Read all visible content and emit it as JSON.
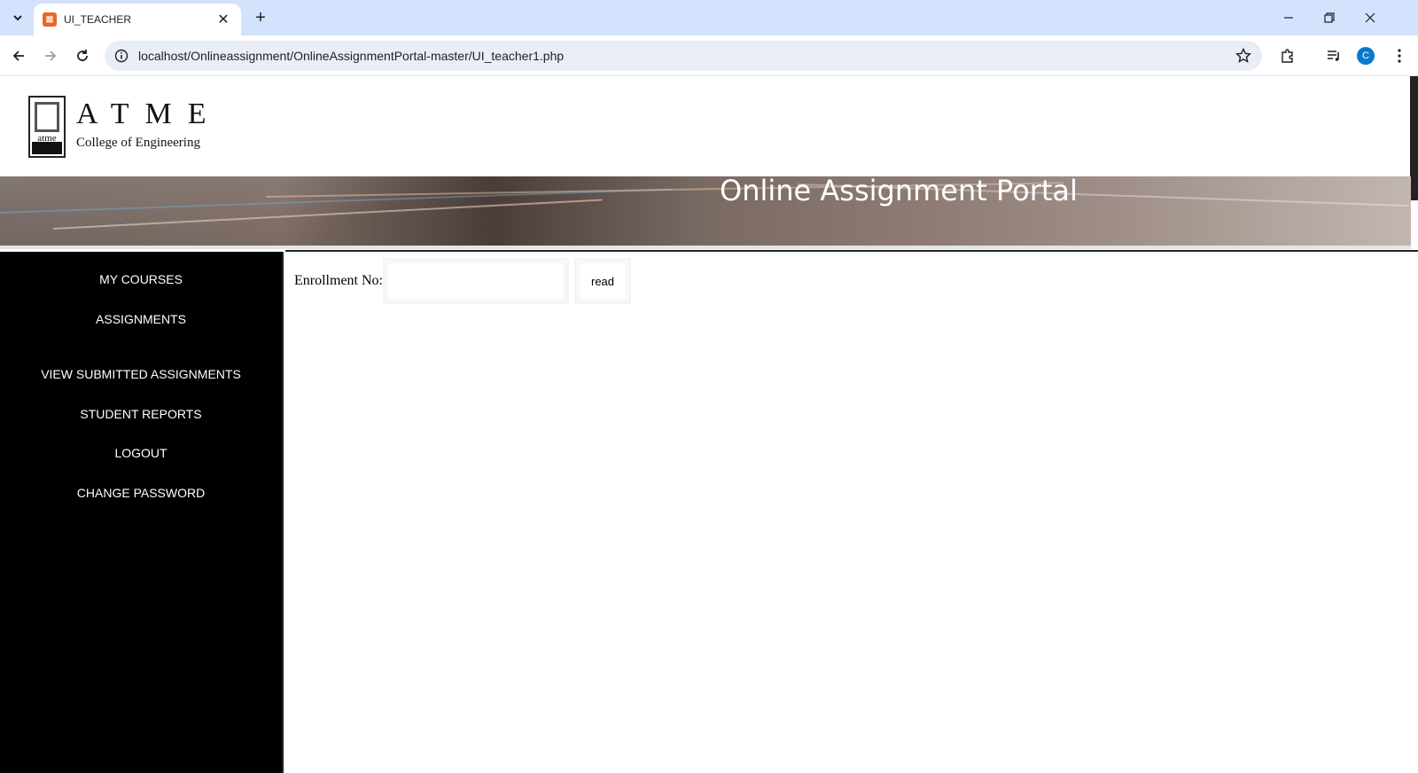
{
  "browser": {
    "tab_title": "UI_TEACHER",
    "url": "localhost/Onlineassignment/OnlineAssignmentPortal-master/UI_teacher1.php",
    "profile_initial": "C"
  },
  "header": {
    "brand_name": "ATME",
    "brand_sub": "College of Engineering",
    "logo_text": "atme",
    "banner_title": "Online Assignment Portal"
  },
  "sidebar": {
    "items": [
      {
        "label": "MY COURSES"
      },
      {
        "label": "ASSIGNMENTS"
      },
      {
        "label": "VIEW SUBMITTED ASSIGNMENTS"
      },
      {
        "label": "STUDENT REPORTS"
      },
      {
        "label": "LOGOUT"
      },
      {
        "label": "CHANGE PASSWORD"
      }
    ]
  },
  "form": {
    "enrollment_label": "Enrollment No:",
    "enrollment_value": "",
    "read_button": "read"
  }
}
